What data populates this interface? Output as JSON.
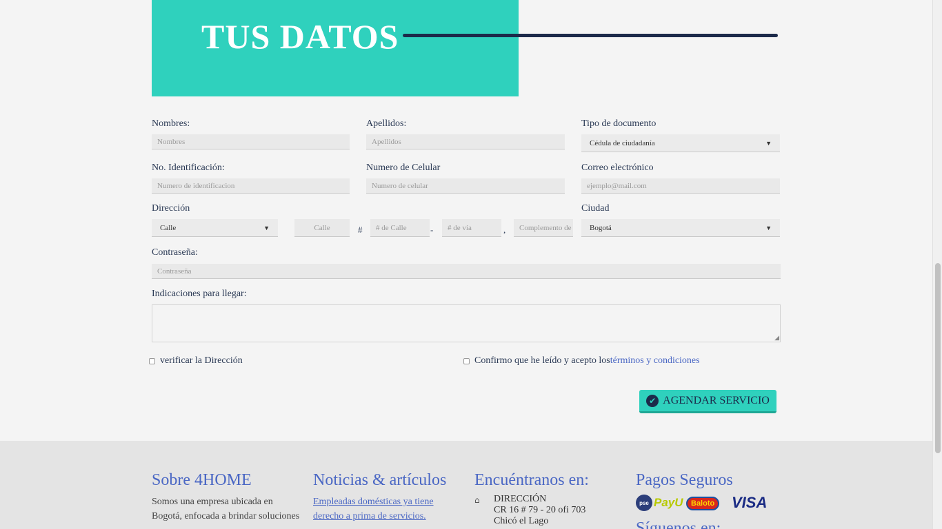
{
  "header": {
    "title": "TUS DATOS"
  },
  "form": {
    "nombres": {
      "label": "Nombres:",
      "placeholder": "Nombres"
    },
    "apellidos": {
      "label": "Apellidos:",
      "placeholder": "Apellidos"
    },
    "tipo_documento": {
      "label": "Tipo de documento",
      "value": "Cédula de ciudadanía"
    },
    "identificacion": {
      "label": "No. Identificación:",
      "placeholder": "Numero de identificacion"
    },
    "celular": {
      "label": "Numero de Celular",
      "placeholder": "Numero de celular"
    },
    "correo": {
      "label": "Correo electrónico",
      "placeholder": "ejemplo@mail.com"
    },
    "direccion": {
      "label": "Dirección",
      "tipo_via": "Calle",
      "calle_placeholder": "Calle",
      "numero_calle_placeholder": "# de Calle",
      "numero_via_placeholder": "# de vía",
      "complemento_placeholder": "Complemento de",
      "sep_hash": "#",
      "sep_dash": "-",
      "sep_comma": ","
    },
    "ciudad": {
      "label": "Ciudad",
      "value": "Bogotá"
    },
    "contrasena": {
      "label": "Contraseña:",
      "placeholder": "Contraseña"
    },
    "indicaciones": {
      "label": "Indicaciones para llegar:"
    },
    "verificar": {
      "label": "verificar la Dirección"
    },
    "terminos": {
      "label": "Confirmo que he leído y acepto los",
      "link": "términos y condiciones"
    },
    "submit": {
      "label": "AGENDAR SERVICIO",
      "icon": "check-circle-icon"
    }
  },
  "footer": {
    "sobre": {
      "heading": "Sobre 4HOME",
      "line1": "Somos una empresa ubicada en",
      "line2": "Bogotá, enfocada a brindar soluciones"
    },
    "noticias": {
      "heading": "Noticias & artículos",
      "article_line1": "Empleadas domésticas ya tiene",
      "article_line2": "derecho a prima de servicios."
    },
    "encuentranos": {
      "heading": "Encuéntranos en:",
      "address_title": "DIRECCIÓN",
      "address_line1": "CR 16 # 79 - 20 ofi 703",
      "address_line2": "Chicó el Lago",
      "icon": "home-icon"
    },
    "pagos": {
      "heading": "Pagos Seguros",
      "logos": [
        "pse",
        "PayU",
        "Baloto",
        "VISA"
      ]
    },
    "siguenos": {
      "heading": "Síguenos en:"
    }
  },
  "colors": {
    "accent": "#2fd1bd",
    "navy": "#1c2a4a",
    "link": "#4a67c4"
  }
}
